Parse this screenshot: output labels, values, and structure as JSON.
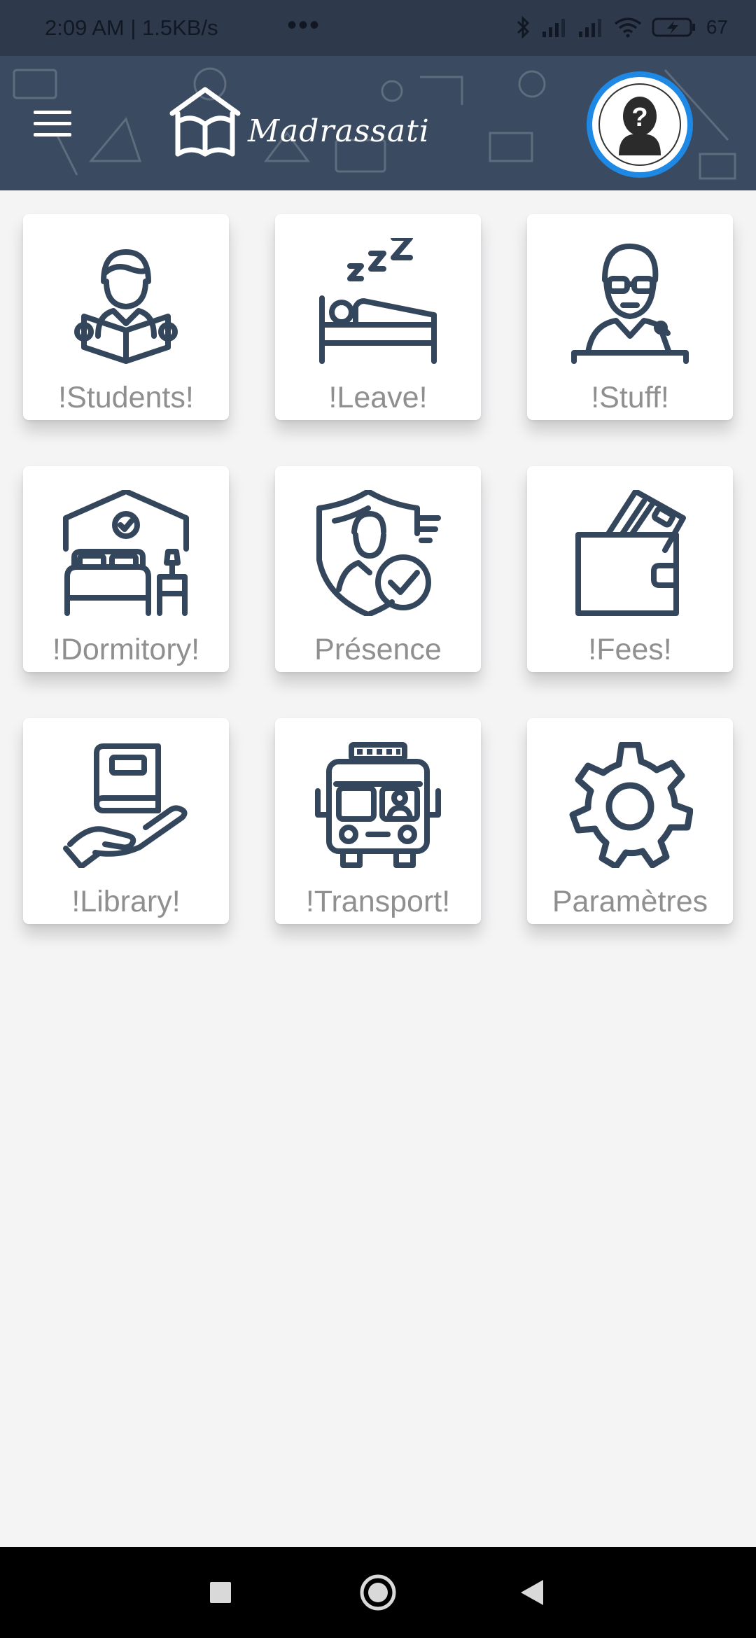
{
  "status_bar": {
    "time": "2:09 AM | 1.5KB/s",
    "more": "•••",
    "battery_text": "67"
  },
  "app_bar": {
    "title": "Madrassati",
    "menu_icon": "hamburger-menu-icon",
    "logo_icon": "house-book-logo-icon",
    "avatar_icon": "unknown-user-question-icon"
  },
  "tiles": [
    {
      "label": "!Students!",
      "icon": "student-reading-icon"
    },
    {
      "label": "!Leave!",
      "icon": "sleeping-bed-icon"
    },
    {
      "label": "!Stuff!",
      "icon": "teacher-podium-icon"
    },
    {
      "label": "!Dormitory!",
      "icon": "bedroom-icon"
    },
    {
      "label": "Présence",
      "icon": "shield-check-person-icon"
    },
    {
      "label": "!Fees!",
      "icon": "wallet-card-icon"
    },
    {
      "label": "!Library!",
      "icon": "hand-book-icon"
    },
    {
      "label": "!Transport!",
      "icon": "bus-icon"
    },
    {
      "label": "Paramètres",
      "icon": "gear-icon"
    }
  ],
  "colors": {
    "app_bar": "#3a4b61",
    "icon_stroke": "#34465c",
    "label": "#8f8f8f",
    "accent_ring": "#1e88e5",
    "background": "#f4f4f5"
  },
  "nav_bar": {
    "recents_icon": "square-recents-icon",
    "home_icon": "circle-home-icon",
    "back_icon": "triangle-back-icon"
  }
}
